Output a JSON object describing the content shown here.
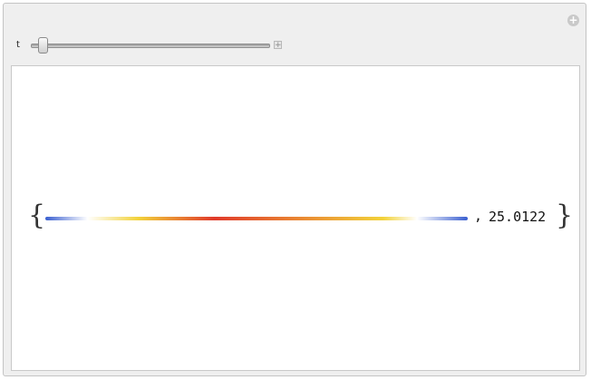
{
  "controls": {
    "variable_label": "t",
    "slider_value": 0.03
  },
  "output": {
    "list_open": "{",
    "list_close": "}",
    "separator": ",",
    "value": "25.0122",
    "gradient_colors": [
      "#3a5fd0",
      "#ffffff",
      "#f2d23a",
      "#e03a2a",
      "#f2d23a",
      "#ffffff",
      "#3a5fd0"
    ]
  }
}
